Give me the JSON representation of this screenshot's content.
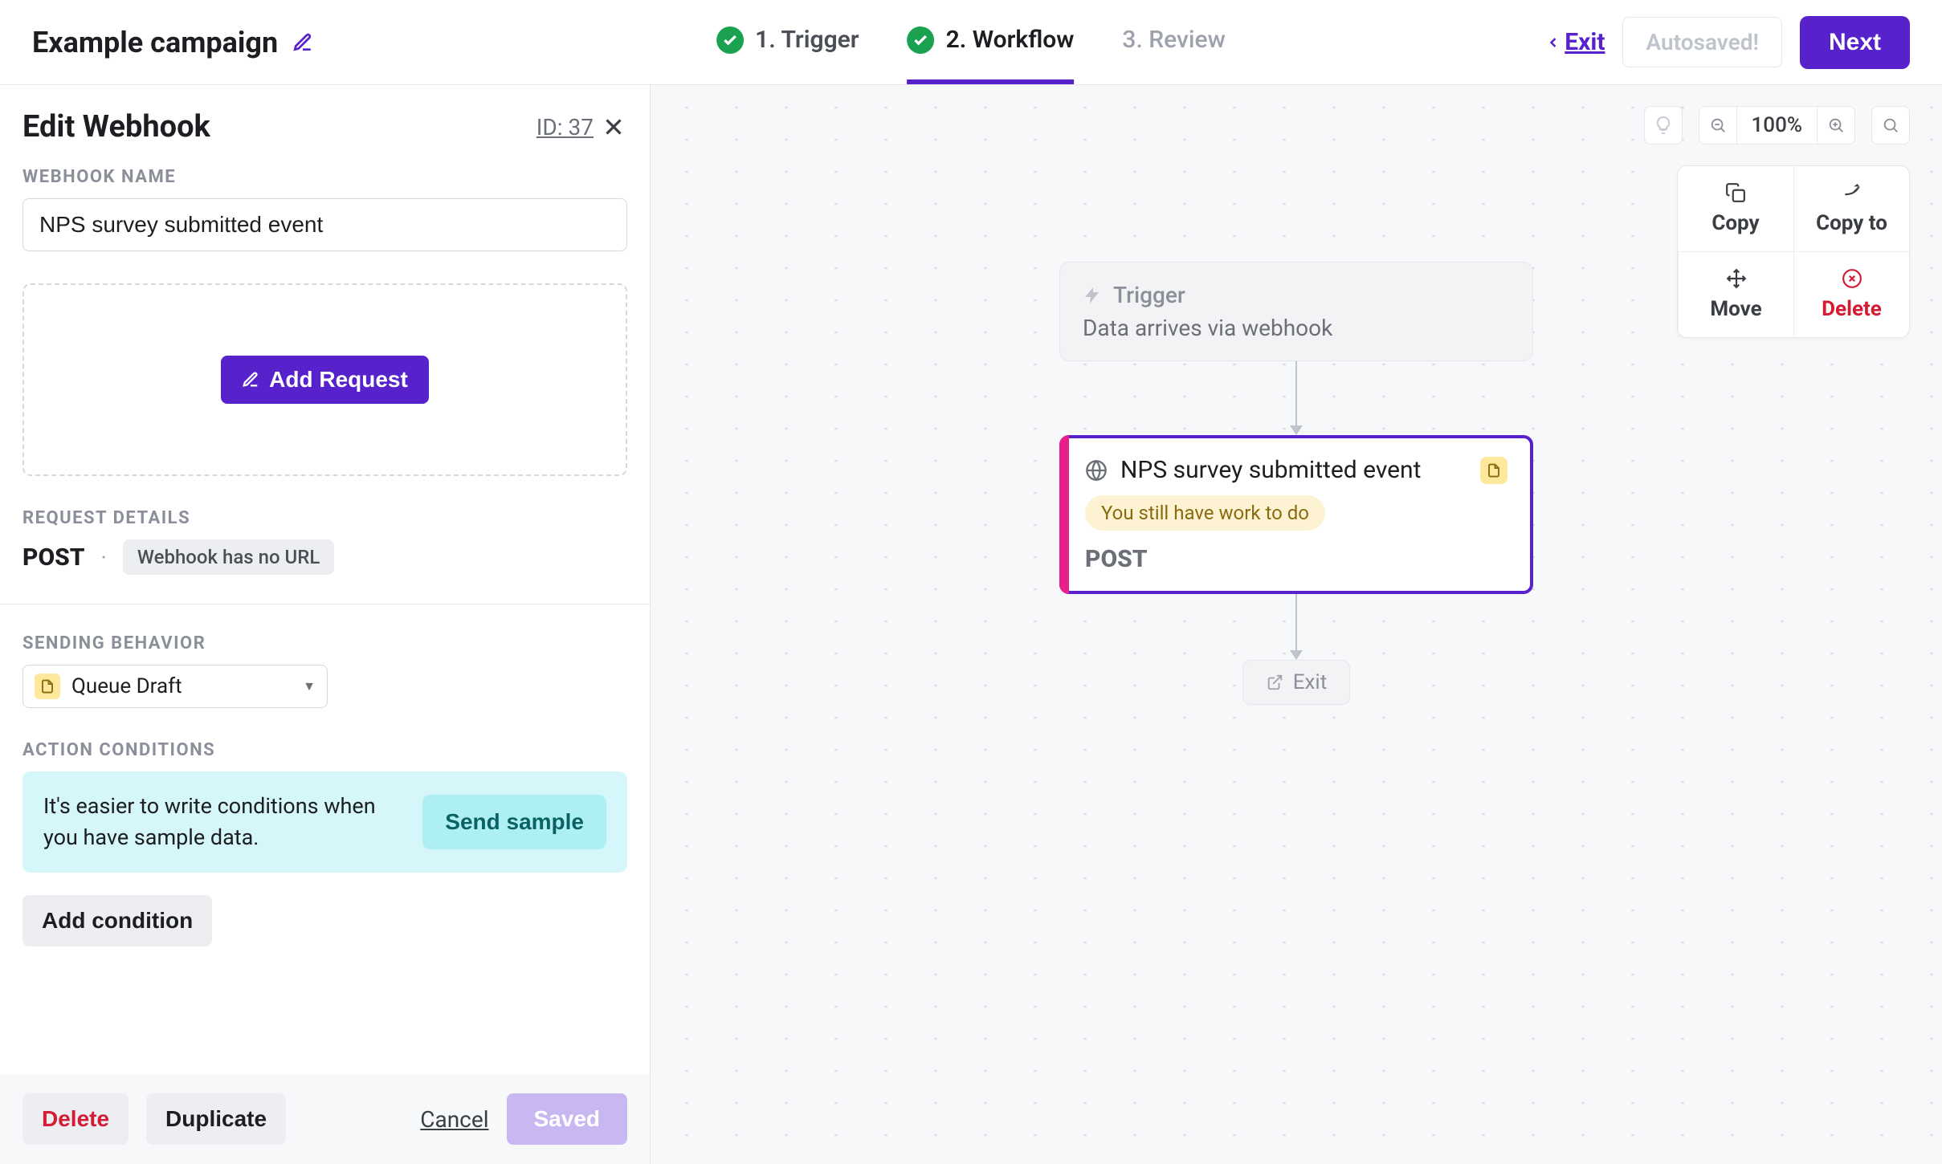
{
  "header": {
    "campaign_name": "Example campaign",
    "steps": {
      "trigger": "1. Trigger",
      "workflow": "2. Workflow",
      "review": "3. Review"
    },
    "exit": "Exit",
    "autosaved": "Autosaved!",
    "next": "Next"
  },
  "sidebar": {
    "title": "Edit Webhook",
    "id_label": "ID: 37",
    "webhook_name_label": "WEBHOOK NAME",
    "webhook_name_value": "NPS survey submitted event",
    "add_request": "Add Request",
    "request_details_label": "REQUEST DETAILS",
    "request_method": "POST",
    "no_url": "Webhook has no URL",
    "sending_behavior_label": "SENDING BEHAVIOR",
    "sending_behavior_value": "Queue Draft",
    "action_conditions_label": "ACTION CONDITIONS",
    "tip_text": "It's easier to write conditions when you have sample data.",
    "send_sample": "Send sample",
    "add_condition": "Add condition",
    "footer": {
      "delete": "Delete",
      "duplicate": "Duplicate",
      "cancel": "Cancel",
      "saved": "Saved"
    }
  },
  "canvas": {
    "zoom": "100%",
    "palette": {
      "copy": "Copy",
      "copy_to": "Copy to",
      "move": "Move",
      "delete": "Delete"
    },
    "trigger": {
      "title": "Trigger",
      "desc": "Data arrives via webhook"
    },
    "webhook_node": {
      "title": "NPS survey submitted event",
      "warning": "You still have work to do",
      "method": "POST"
    },
    "exit": "Exit"
  }
}
